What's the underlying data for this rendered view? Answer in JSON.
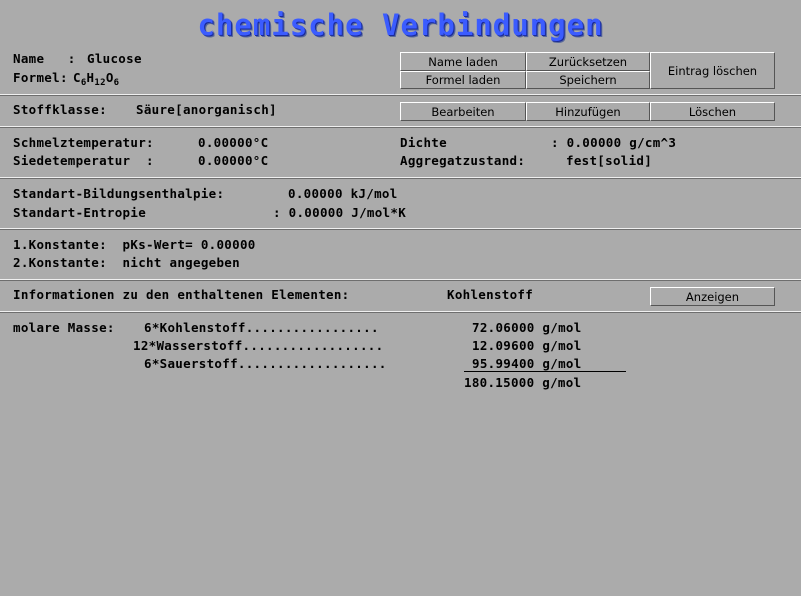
{
  "title": "chemische Verbindungen",
  "compound": {
    "name_label": "Name   :",
    "name_value": "Glucose",
    "formula_label": "Formel:",
    "formula": [
      {
        "el": "C",
        "n": "6"
      },
      {
        "el": "H",
        "n": "12"
      },
      {
        "el": "O",
        "n": "6"
      }
    ]
  },
  "top_buttons": {
    "load_name": "Name laden",
    "reset": "Zurücksetzen",
    "load_formula": "Formel laden",
    "save": "Speichern",
    "delete_entry": "Eintrag löschen"
  },
  "class_row": {
    "label": "Stoffklasse:",
    "value": "Säure[anorganisch]",
    "edit": "Bearbeiten",
    "add": "Hinzufügen",
    "delete": "Löschen"
  },
  "properties": {
    "melting_label": "Schmelztemperatur:",
    "melting_value": "0.00000°C",
    "boiling_label": "Siedetemperatur  :",
    "boiling_value": "0.00000°C",
    "density_label": "Dichte",
    "density_value": ": 0.00000 g/cm^3",
    "state_label": "Aggregatzustand:",
    "state_value": "fest[solid]"
  },
  "thermo": {
    "enthalpy_label": "Standart-Bildungsenthalpie:",
    "enthalpy_value": "0.00000 kJ/mol",
    "entropy_label": "Standart-Entropie",
    "entropy_value": ": 0.00000 J/mol*K"
  },
  "constants": {
    "first": "1.Konstante:  pKs-Wert= 0.00000",
    "second": "2.Konstante:  nicht angegeben"
  },
  "elements": {
    "label": "Informationen zu den enthaltenen Elementen:",
    "selected": "Kohlenstoff",
    "show": "Anzeigen"
  },
  "molar_mass": {
    "label": "molare Masse:",
    "rows": [
      {
        "term": "6*Kohlenstoff.................",
        "value": "72.06000 g/mol"
      },
      {
        "term": "12*Wasserstoff..................",
        "value": "12.09600 g/mol"
      },
      {
        "term": "6*Sauerstoff...................",
        "value": "95.99400 g/mol"
      }
    ],
    "total": "180.15000 g/mol"
  }
}
